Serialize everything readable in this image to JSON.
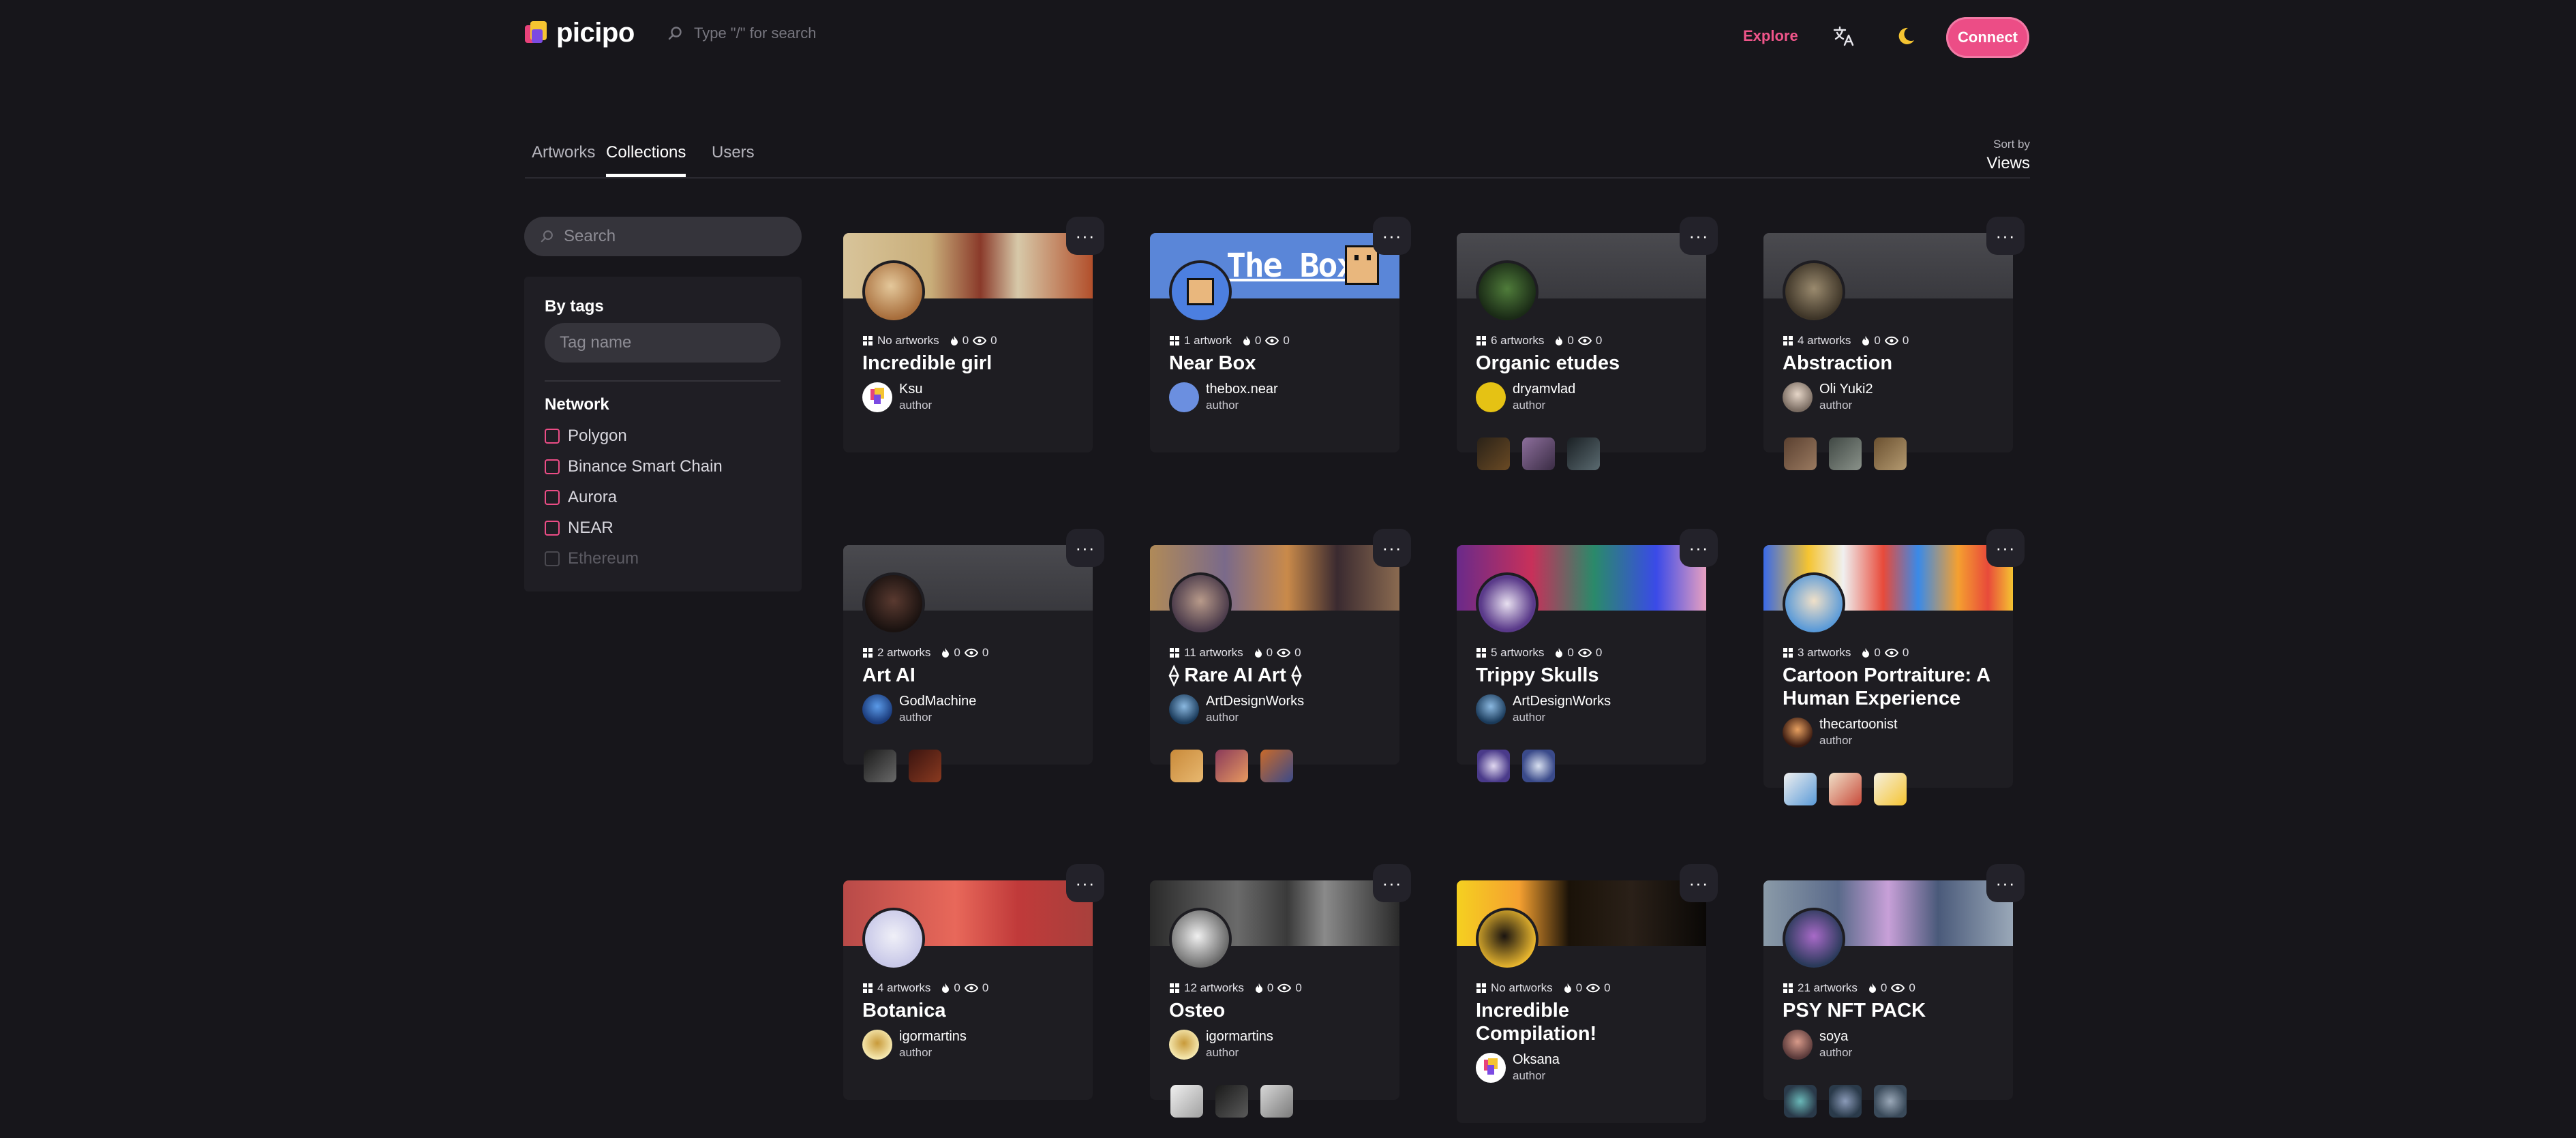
{
  "header": {
    "logo_text": "picipo",
    "search_placeholder": "Type \"/\" for search",
    "explore_label": "Explore",
    "connect_label": "Connect"
  },
  "tabs": {
    "items": [
      "Artworks",
      "Collections",
      "Users"
    ],
    "active": "Collections",
    "sort_label": "Sort by",
    "sort_value": "Views"
  },
  "sidebar": {
    "search_placeholder": "Search",
    "by_tags_title": "By tags",
    "tag_placeholder": "Tag name",
    "network_title": "Network",
    "networks": [
      {
        "label": "Polygon",
        "enabled": true
      },
      {
        "label": "Binance Smart Chain",
        "enabled": true
      },
      {
        "label": "Aurora",
        "enabled": true
      },
      {
        "label": "NEAR",
        "enabled": true
      },
      {
        "label": "Ethereum",
        "enabled": false
      }
    ]
  },
  "collections": [
    {
      "artworks": "No artworks",
      "likes": "0",
      "views": "0",
      "title": "Incredible girl",
      "author": "Ksu",
      "role": "author"
    },
    {
      "artworks": "1 artwork",
      "likes": "0",
      "views": "0",
      "title": "Near Box",
      "author": "thebox.near",
      "role": "author",
      "cover_text": "The Box"
    },
    {
      "artworks": "6 artworks",
      "likes": "0",
      "views": "0",
      "title": "Organic etudes",
      "author": "dryamvlad",
      "role": "author"
    },
    {
      "artworks": "4 artworks",
      "likes": "0",
      "views": "0",
      "title": "Abstraction",
      "author": "Oli Yuki2",
      "role": "author"
    },
    {
      "artworks": "2 artworks",
      "likes": "0",
      "views": "0",
      "title": "Art AI",
      "author": "GodMachine",
      "role": "author"
    },
    {
      "artworks": "11 artworks",
      "likes": "0",
      "views": "0",
      "title": "⟠ Rare AI Art ⟠",
      "author": "ArtDesignWorks",
      "role": "author"
    },
    {
      "artworks": "5 artworks",
      "likes": "0",
      "views": "0",
      "title": "Trippy Skulls",
      "author": "ArtDesignWorks",
      "role": "author"
    },
    {
      "artworks": "3 artworks",
      "likes": "0",
      "views": "0",
      "title": "Cartoon Portraiture: A Human Experience",
      "author": "thecartoonist",
      "role": "author"
    },
    {
      "artworks": "4 artworks",
      "likes": "0",
      "views": "0",
      "title": "Botanica",
      "author": "igormartins",
      "role": "author"
    },
    {
      "artworks": "12 artworks",
      "likes": "0",
      "views": "0",
      "title": "Osteo",
      "author": "igormartins",
      "role": "author"
    },
    {
      "artworks": "No artworks",
      "likes": "0",
      "views": "0",
      "title": "Incredible Compilation!",
      "author": "Oksana",
      "role": "author"
    },
    {
      "artworks": "21 artworks",
      "likes": "0",
      "views": "0",
      "title": "PSY NFT PACK",
      "author": "soya",
      "role": "author"
    }
  ],
  "colors": {
    "accent": "#ec4d86",
    "background": "#17161b",
    "card": "#1e1d22",
    "moon": "#f5c431"
  },
  "icons": [
    "search-icon",
    "translate-icon",
    "moon-icon",
    "grid-icon",
    "flame-icon",
    "eye-icon",
    "more-icon"
  ]
}
